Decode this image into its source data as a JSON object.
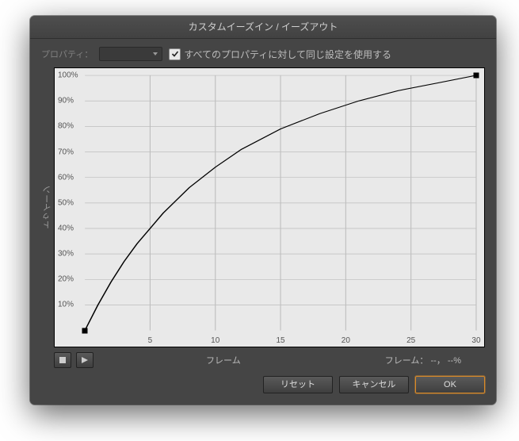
{
  "dialog": {
    "title": "カスタムイーズイン / イーズアウト"
  },
  "property": {
    "label": "プロパティ：",
    "selected": ""
  },
  "checkbox": {
    "checked": true,
    "label": "すべてのプロパティに対して同じ設定を使用する"
  },
  "axes": {
    "y_label": "トゥイーン",
    "x_label": "フレーム",
    "y_ticks": [
      "10%",
      "20%",
      "30%",
      "40%",
      "50%",
      "60%",
      "70%",
      "80%",
      "90%",
      "100%"
    ],
    "x_ticks": [
      "5",
      "10",
      "15",
      "20",
      "25",
      "30"
    ]
  },
  "readout": {
    "label": "フレーム：",
    "frame_value": "--",
    "percent_value": "--%"
  },
  "buttons": {
    "reset": "リセット",
    "cancel": "キャンセル",
    "ok": "OK"
  },
  "chart_data": {
    "type": "line",
    "title": "",
    "xlabel": "フレーム",
    "ylabel": "トゥイーン",
    "xlim": [
      0,
      30
    ],
    "ylim": [
      0,
      100
    ],
    "x": [
      0,
      1,
      2,
      3,
      4,
      5,
      6,
      8,
      10,
      12,
      15,
      18,
      21,
      24,
      27,
      30
    ],
    "values": [
      0,
      10,
      19,
      27,
      34,
      40,
      46,
      56,
      64,
      71,
      79,
      85,
      90,
      94,
      97,
      100
    ],
    "control_points": [
      {
        "frame": 0,
        "percent": 0
      },
      {
        "frame": 30,
        "percent": 100
      }
    ]
  }
}
